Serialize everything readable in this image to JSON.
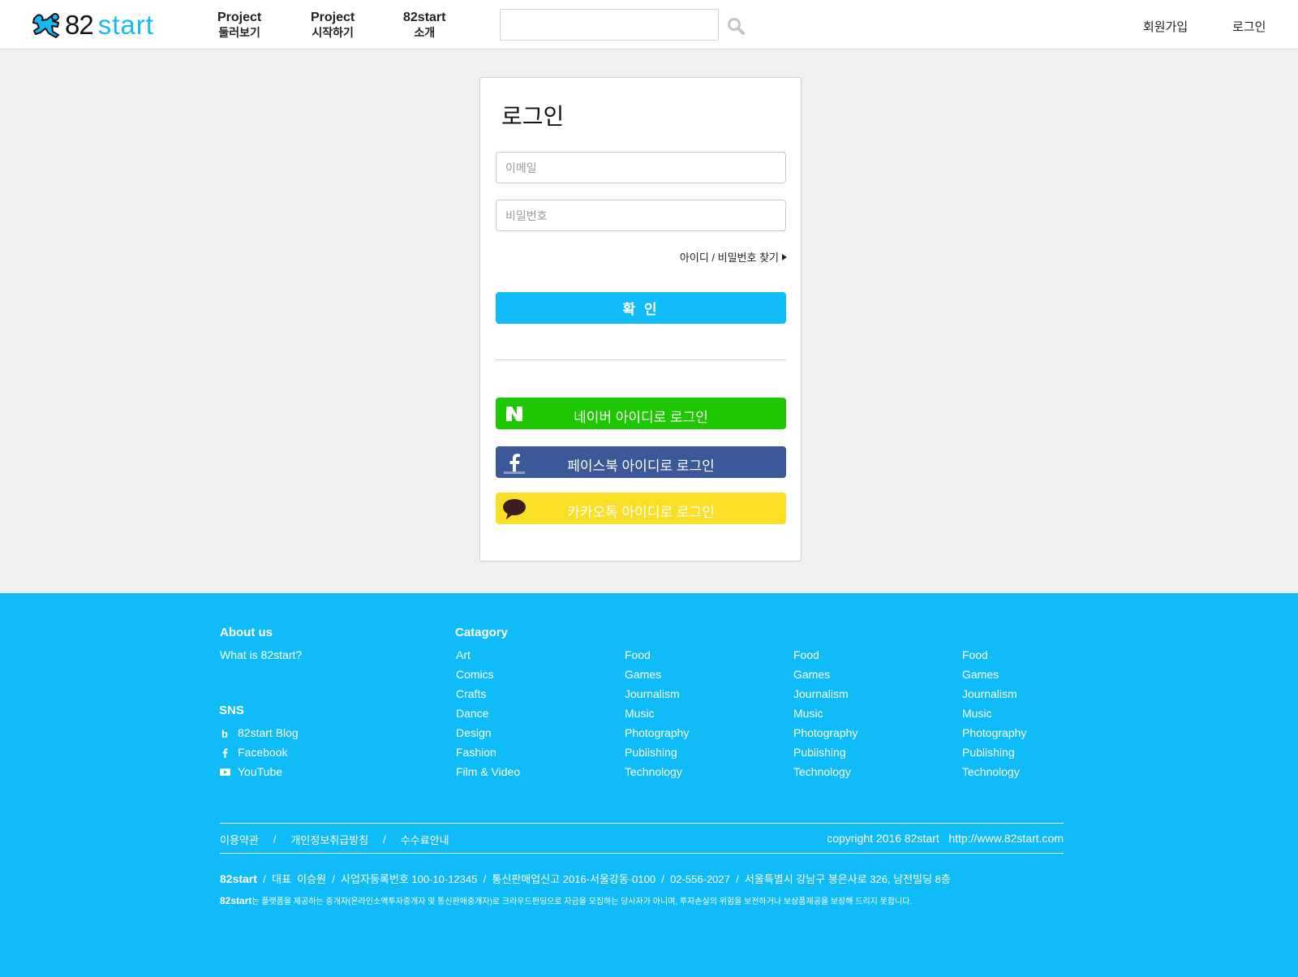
{
  "header": {
    "logo_number": "82",
    "logo_word": "start",
    "nav": [
      {
        "line1": "Project",
        "line2": "둘러보기"
      },
      {
        "line1": "Project",
        "line2": "시작하기"
      },
      {
        "line1": "82start",
        "line2": "소개"
      }
    ],
    "search_value": "",
    "signup": "회원가입",
    "login": "로그인"
  },
  "login": {
    "title": "로그인",
    "email_placeholder": "이메일",
    "password_placeholder": "비밀번호",
    "find_account": "아이디 / 비밀번호 찾기",
    "confirm": "확 인",
    "naver": "네이버 아이디로 로그인",
    "facebook": "페이스북 아이디로 로그인",
    "kakao": "카카오톡 아이디로 로그인"
  },
  "footer": {
    "about_heading": "About us",
    "about_link": "What is 82start?",
    "sns_heading": "SNS",
    "sns": [
      "82start Blog",
      "Facebook",
      "YouTube"
    ],
    "category_heading": "Catagory",
    "categories": [
      [
        "Art",
        "Comics",
        "Crafts",
        "Dance",
        "Design",
        "Fashion",
        "Film & Video"
      ],
      [
        "Food",
        "Games",
        "Journalism",
        "Music",
        "Photography",
        "Publishing",
        "Technology"
      ],
      [
        "Food",
        "Games",
        "Journalism",
        "Music",
        "Photography",
        "Publishing",
        "Technology"
      ],
      [
        "Food",
        "Games",
        "Journalism",
        "Music",
        "Photography",
        "Publishing",
        "Technology"
      ]
    ],
    "policies": [
      "이용약관",
      "개인정보취급방침",
      "수수료안내"
    ],
    "separator": "/",
    "copyright": "copyright 2016 82start   http://www.82start.com",
    "company_name": "82start",
    "company_info": "  /  대표  이승원  /  사업자등록번호 100-10-12345  /  통신판매업신고 2016-서울강동-0100  /  02-556-2027  /  서울특별시 강남구 봉은사로 326, 남전빌딩 8층",
    "disclaimer_name": "82start",
    "disclaimer_text": "는 플랫폼을 제공하는 중개자(온라인소액투자중개자 및 통신판매중개자)로 크라우드펀딩으로 자금을 모집하는 당사자가 아니며, 투자손실의 위험을 보전하거나 보상품제공을 보장해 드리지 못합니다."
  },
  "colors": {
    "brand_blue": "#10bcf8",
    "naver_green": "#1ec800",
    "facebook_blue": "#3b5998",
    "kakao_yellow": "#f9df26"
  }
}
